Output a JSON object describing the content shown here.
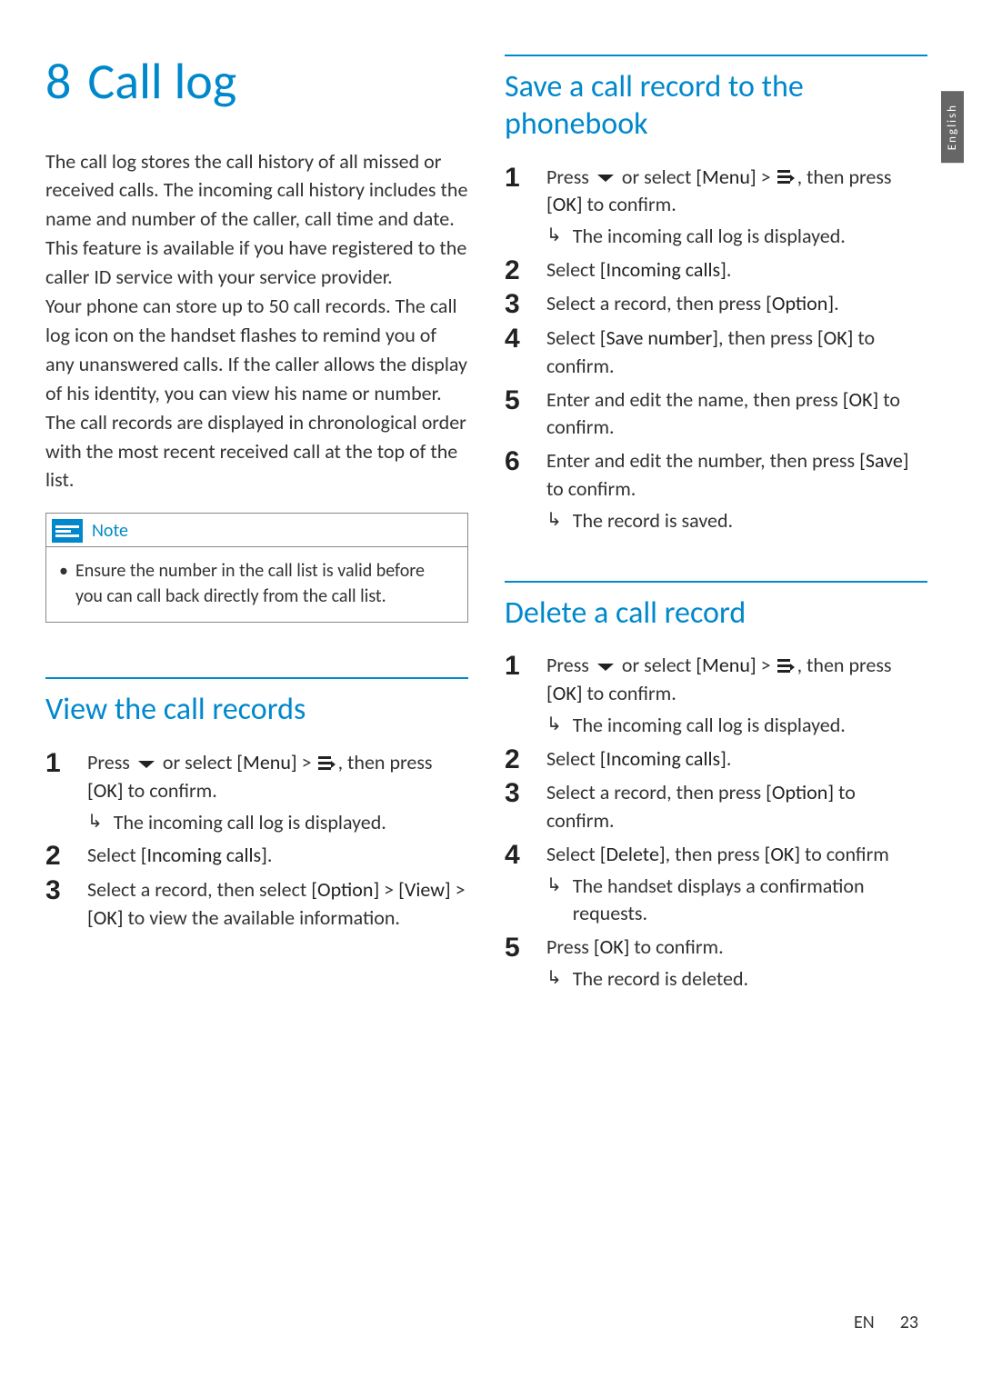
{
  "chapter": {
    "num": "8",
    "title": "Call log"
  },
  "intro_para": "The call log stores the call history of all missed or received calls. The incoming call history includes the name and number of the caller, call time and date. This feature is available if you have registered to the caller ID service with your service provider.\nYour phone can store up to 50 call records. The call log icon on the handset flashes to remind you of any unanswered calls. If the caller allows the display of his identity, you can view his name or number. The call records are displayed in chronological order with the most recent received call at the top of the list.",
  "note": {
    "label": "Note",
    "text": "Ensure the number in the call list is valid before you can call back directly from the call list."
  },
  "section_view": {
    "heading": "View the call records",
    "steps": {
      "s1": {
        "pre": "Press ",
        "mid": " or select ",
        "menu": "[Menu]",
        "gt": " > ",
        "post": ", then press ",
        "ok": "[OK]",
        "tail": " to confirm.",
        "result": "The incoming call log is displayed."
      },
      "s2": {
        "pre": "Select ",
        "b": "[Incoming calls]",
        "tail": "."
      },
      "s3": {
        "pre": "Select a record, then select ",
        "b1": "[Option]",
        "mid1": " > ",
        "b2": "[View]",
        "mid2": " > ",
        "b3": "[OK]",
        "tail": " to view the available information."
      }
    }
  },
  "section_save": {
    "heading": "Save a call record to the phonebook",
    "steps": {
      "s1": {
        "pre": "Press ",
        "mid": " or select ",
        "menu": "[Menu]",
        "gt": " > ",
        "post": ", then press ",
        "ok": "[OK]",
        "tail": " to confirm.",
        "result": "The incoming call log is displayed."
      },
      "s2": {
        "pre": "Select ",
        "b": "[Incoming calls]",
        "tail": "."
      },
      "s3": {
        "pre": "Select a record, then press ",
        "b": "[Option]",
        "tail": "."
      },
      "s4": {
        "pre": "Select ",
        "b1": "[Save number]",
        "mid": ", then press ",
        "b2": "[OK]",
        "tail": " to confirm."
      },
      "s5": {
        "pre": "Enter and edit the name, then press ",
        "b": "[OK]",
        "tail": " to confirm."
      },
      "s6": {
        "pre": "Enter and edit the number, then press ",
        "b": "[Save]",
        "tail": " to confirm.",
        "result": "The record is saved."
      }
    }
  },
  "section_delete": {
    "heading": "Delete a call record",
    "steps": {
      "s1": {
        "pre": "Press ",
        "mid": " or select ",
        "menu": "[Menu]",
        "gt": " > ",
        "post": ", then press ",
        "ok": "[OK]",
        "tail": " to confirm.",
        "result": "The incoming call log is displayed."
      },
      "s2": {
        "pre": "Select ",
        "b": "[Incoming calls]",
        "tail": "."
      },
      "s3": {
        "pre": "Select a record, then press ",
        "b": "[Option]",
        "tail": " to confirm."
      },
      "s4": {
        "pre": "Select ",
        "b1": "[Delete]",
        "mid": ", then press ",
        "b2": "[OK]",
        "tail": " to confirm",
        "result": "The handset displays a confirmation requests."
      },
      "s5": {
        "pre": "Press ",
        "b": "[OK]",
        "tail": " to confirm.",
        "result": "The record is deleted."
      }
    }
  },
  "side_tab": "English",
  "footer": {
    "lang": "EN",
    "page": "23"
  }
}
